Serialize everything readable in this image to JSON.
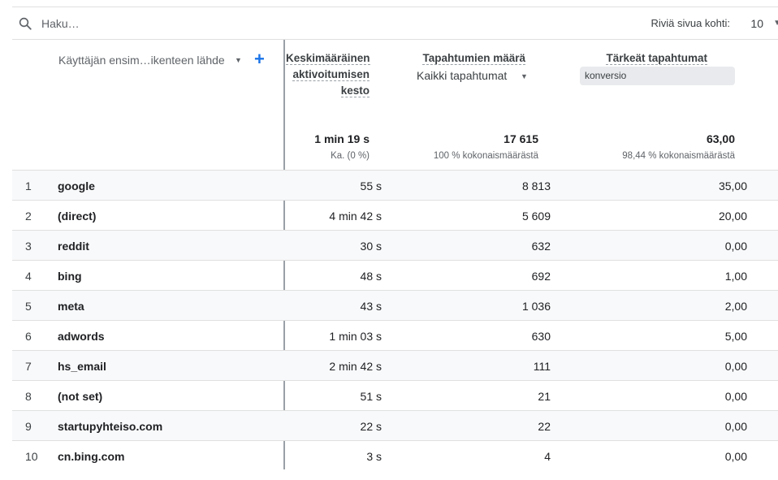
{
  "search": {
    "placeholder": "Haku…",
    "icon": "search-icon"
  },
  "pagination": {
    "rows_per_page_label": "Riviä sivua kohti:",
    "rows_per_page_value": "10"
  },
  "table": {
    "dimension_header": "Käyttäjän ensim…ikenteen lähde",
    "columns": [
      {
        "label_lines": [
          "Keskimääräinen",
          "aktivoitumisen",
          "kesto"
        ],
        "total": "1 min 19 s",
        "total_sub": "Ka. (0 %)"
      },
      {
        "label": "Tapahtumien määrä",
        "sub_select": "Kaikki tapahtumat",
        "total": "17 615",
        "total_sub": "100 % kokonaismäärästä"
      },
      {
        "label": "Tärkeät tapahtumat",
        "filter": "konversio",
        "total": "63,00",
        "total_sub": "98,44 % kokonaismäärästä"
      }
    ],
    "rows": [
      {
        "idx": "1",
        "name": "google",
        "v1": "55 s",
        "v2": "8 813",
        "v3": "35,00"
      },
      {
        "idx": "2",
        "name": "(direct)",
        "v1": "4 min 42 s",
        "v2": "5 609",
        "v3": "20,00"
      },
      {
        "idx": "3",
        "name": "reddit",
        "v1": "30 s",
        "v2": "632",
        "v3": "0,00"
      },
      {
        "idx": "4",
        "name": "bing",
        "v1": "48 s",
        "v2": "692",
        "v3": "1,00"
      },
      {
        "idx": "5",
        "name": "meta",
        "v1": "43 s",
        "v2": "1 036",
        "v3": "2,00"
      },
      {
        "idx": "6",
        "name": "adwords",
        "v1": "1 min 03 s",
        "v2": "630",
        "v3": "5,00"
      },
      {
        "idx": "7",
        "name": "hs_email",
        "v1": "2 min 42 s",
        "v2": "111",
        "v3": "0,00"
      },
      {
        "idx": "8",
        "name": "(not set)",
        "v1": "51 s",
        "v2": "21",
        "v3": "0,00"
      },
      {
        "idx": "9",
        "name": "startupyhteiso.com",
        "v1": "22 s",
        "v2": "22",
        "v3": "0,00"
      },
      {
        "idx": "10",
        "name": "cn.bing.com",
        "v1": "3 s",
        "v2": "4",
        "v3": "0,00"
      }
    ]
  },
  "colors": {
    "accent": "#1a73e8",
    "row_alt": "#f8f9fa",
    "divider": "#e0e0e0"
  }
}
